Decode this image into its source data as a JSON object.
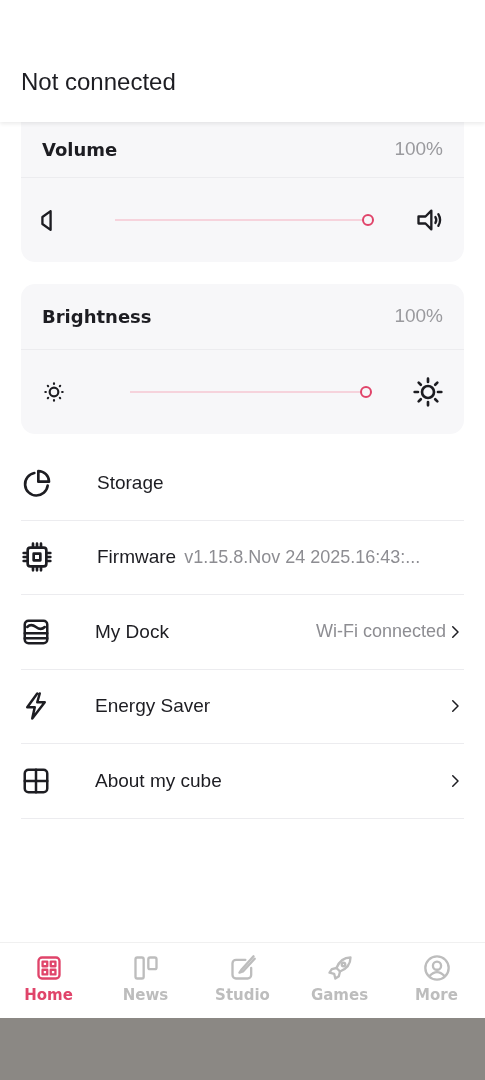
{
  "header": {
    "title": "Not connected"
  },
  "controls": [
    {
      "kind": "volume",
      "label": "Volume",
      "reading": "100%",
      "level": 1
    },
    {
      "kind": "brightness",
      "label": "Brightness",
      "reading": "100%",
      "level": 1
    }
  ],
  "menu": [
    {
      "kind": "storage",
      "label": "Storage",
      "has_chevron": false
    },
    {
      "kind": "firmware",
      "label": "Firmware",
      "value": "v1.15.8.Nov 24 2025.16:43:...",
      "has_chevron": false
    },
    {
      "kind": "dock",
      "label": "My Dock",
      "value": "Wi-Fi connected",
      "has_chevron": true
    },
    {
      "kind": "energy",
      "label": "Energy Saver",
      "has_chevron": true
    },
    {
      "kind": "about",
      "label": "About my cube",
      "has_chevron": true
    }
  ],
  "tabs": [
    {
      "kind": "home",
      "label": "Home",
      "selected": true
    },
    {
      "kind": "news",
      "label": "News",
      "selected": false
    },
    {
      "kind": "studio",
      "label": "Studio",
      "selected": false
    },
    {
      "kind": "games",
      "label": "Games",
      "selected": false
    },
    {
      "kind": "more",
      "label": "More",
      "selected": false
    }
  ]
}
